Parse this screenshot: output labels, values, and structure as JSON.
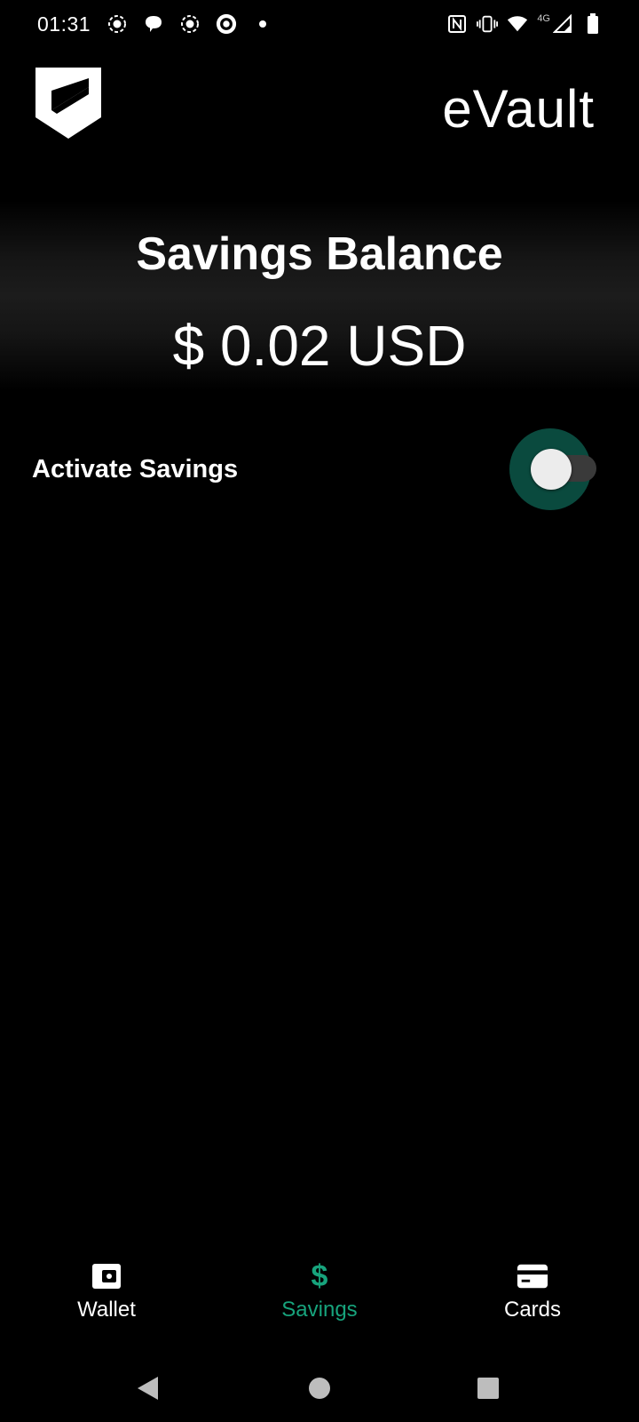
{
  "status_bar": {
    "time": "01:31",
    "network_label": "4G",
    "left_icons": [
      "notification-circle-icon",
      "chat-bubble-icon",
      "notification-circle-icon",
      "target-icon",
      "dot-icon"
    ],
    "right_icons": [
      "nfc-icon",
      "vibrate-icon",
      "wifi-icon",
      "signal-icon",
      "battery-icon"
    ]
  },
  "header": {
    "title": "eVault",
    "logo_icon": "evault-logo-icon"
  },
  "balance": {
    "title": "Savings Balance",
    "amount": "$ 0.02 USD"
  },
  "settings": {
    "activate_label": "Activate Savings",
    "activate_on": false
  },
  "bottom_nav": {
    "items": [
      {
        "label": "Wallet",
        "icon": "wallet-icon",
        "active": false
      },
      {
        "label": "Savings",
        "icon": "dollar-icon",
        "active": true
      },
      {
        "label": "Cards",
        "icon": "card-icon",
        "active": false
      }
    ]
  },
  "system_nav": [
    "back-icon",
    "home-icon",
    "recents-icon"
  ],
  "colors": {
    "background": "#000000",
    "accent": "#17a37c",
    "toggle_halo": "#0a4a3e",
    "text": "#ffffff"
  }
}
